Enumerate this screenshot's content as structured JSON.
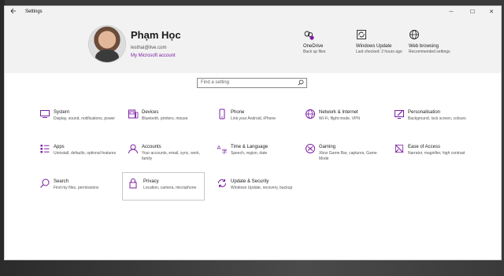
{
  "window": {
    "title": "Settings",
    "back_icon": "back-arrow-icon",
    "controls": {
      "minimize": "─",
      "maximize": "☐",
      "close": "✕"
    }
  },
  "account": {
    "name": "Phạm Học",
    "email": "lesthai@live.com",
    "link": "My Microsoft account"
  },
  "header_items": [
    {
      "icon": "onedrive-icon",
      "title": "OneDrive",
      "subtitle": "Back up files"
    },
    {
      "icon": "windows-update-icon",
      "title": "Windows Update",
      "subtitle": "Last checked: 2 hours ago"
    },
    {
      "icon": "web-browsing-icon",
      "title": "Web browsing",
      "subtitle": "Recommended settings"
    }
  ],
  "search": {
    "placeholder": "Find a setting"
  },
  "categories": [
    {
      "icon": "system-icon",
      "title": "System",
      "desc": "Display, sound, notifications, power"
    },
    {
      "icon": "devices-icon",
      "title": "Devices",
      "desc": "Bluetooth, printers, mouse"
    },
    {
      "icon": "phone-icon",
      "title": "Phone",
      "desc": "Link your Android, iPhone"
    },
    {
      "icon": "network-icon",
      "title": "Network & Internet",
      "desc": "Wi-Fi, flight mode, VPN"
    },
    {
      "icon": "personalisation-icon",
      "title": "Personalisation",
      "desc": "Background, lock screen, colours"
    },
    {
      "icon": "apps-icon",
      "title": "Apps",
      "desc": "Uninstall, defaults, optional features"
    },
    {
      "icon": "accounts-icon",
      "title": "Accounts",
      "desc": "Your accounts, email, sync, work, family"
    },
    {
      "icon": "time-language-icon",
      "title": "Time & Language",
      "desc": "Speech, region, date"
    },
    {
      "icon": "gaming-icon",
      "title": "Gaming",
      "desc": "Xbox Game Bar, captures, Game Mode"
    },
    {
      "icon": "ease-of-access-icon",
      "title": "Ease of Access",
      "desc": "Narrator, magnifier, high contrast"
    },
    {
      "icon": "search-icon",
      "title": "Search",
      "desc": "Find my files, permissions"
    },
    {
      "icon": "privacy-icon",
      "title": "Privacy",
      "desc": "Location, camera, microphone"
    },
    {
      "icon": "update-security-icon",
      "title": "Update & Security",
      "desc": "Windows Update, recovery, backup"
    }
  ],
  "colors": {
    "accent": "#7b1fa2",
    "header_bg": "#f2f2f2",
    "window_bg": "#ffffff"
  }
}
